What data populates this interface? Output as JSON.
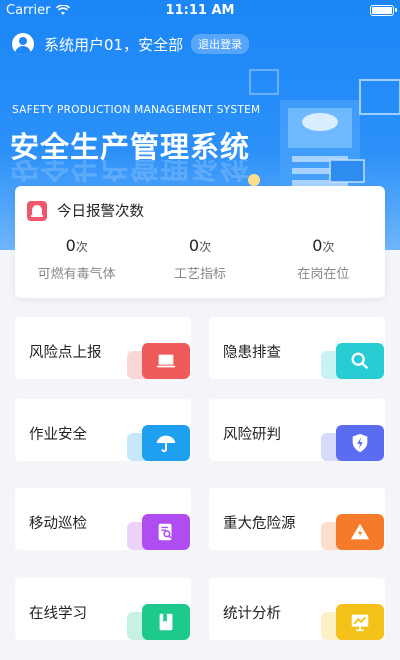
{
  "status_bar": {
    "carrier": "Carrier",
    "time": "11:11 AM"
  },
  "user": {
    "name": "系统用户01，安全部",
    "logout_label": "退出登录"
  },
  "header": {
    "english_title": "SAFETY PRODUCTION MANAGEMENT SYSTEM",
    "chinese_title": "安全生产管理系统"
  },
  "alarm": {
    "title": "今日报警次数",
    "unit": "次",
    "stats": [
      {
        "value": "0",
        "label": "可燃有毒气体"
      },
      {
        "value": "0",
        "label": "工艺指标"
      },
      {
        "value": "0",
        "label": "在岗在位"
      }
    ]
  },
  "menu": [
    {
      "label": "风险点上报",
      "icon": "laptop-icon",
      "color": "#ef5a5a"
    },
    {
      "label": "隐患排查",
      "icon": "magnifier-icon",
      "color": "#28cdd4"
    },
    {
      "label": "作业安全",
      "icon": "umbrella-icon",
      "color": "#1f9ff0"
    },
    {
      "label": "风险研判",
      "icon": "shield-bolt-icon",
      "color": "#5a6df0"
    },
    {
      "label": "移动巡检",
      "icon": "document-search-icon",
      "color": "#b04df0"
    },
    {
      "label": "重大危险源",
      "icon": "warning-triangle-icon",
      "color": "#f57a2a"
    },
    {
      "label": "在线学习",
      "icon": "book-icon",
      "color": "#1ec98c"
    },
    {
      "label": "统计分析",
      "icon": "chart-board-icon",
      "color": "#f5c21a"
    }
  ],
  "colors": {
    "primary": "#1b86f7",
    "alarm": "#f0576b"
  }
}
